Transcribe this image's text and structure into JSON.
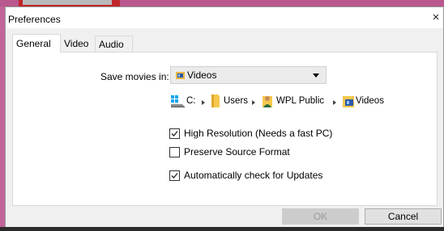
{
  "dialog": {
    "title": "Preferences",
    "close_glyph": "×"
  },
  "tabs": [
    {
      "label": "General",
      "active": true
    },
    {
      "label": "Video",
      "active": false
    },
    {
      "label": "Audio",
      "active": false
    }
  ],
  "general": {
    "save_label": "Save movies in:",
    "save_location": {
      "value": "Videos",
      "icon": "videos-folder-icon"
    },
    "path": [
      {
        "label": "C:",
        "icon": "drive-icon"
      },
      {
        "label": "Users",
        "icon": "folder-icon"
      },
      {
        "label": "WPL Public",
        "icon": "user-folder-icon"
      },
      {
        "label": "Videos",
        "icon": "videos-folder-icon"
      }
    ],
    "options": [
      {
        "label": "High Resolution (Needs a fast PC)",
        "checked": true
      },
      {
        "label": "Preserve Source Format",
        "checked": false
      },
      {
        "label": "Automatically check for Updates",
        "checked": true
      }
    ]
  },
  "buttons": {
    "ok_label": "OK",
    "ok_enabled": false,
    "cancel_label": "Cancel"
  },
  "colors": {
    "background": "#c2649a",
    "accent_red": "#c0262b",
    "dialog_bg": "#ffffff",
    "chrome_bg": "#f0f0f0",
    "disabled_button": "#cccccc"
  }
}
